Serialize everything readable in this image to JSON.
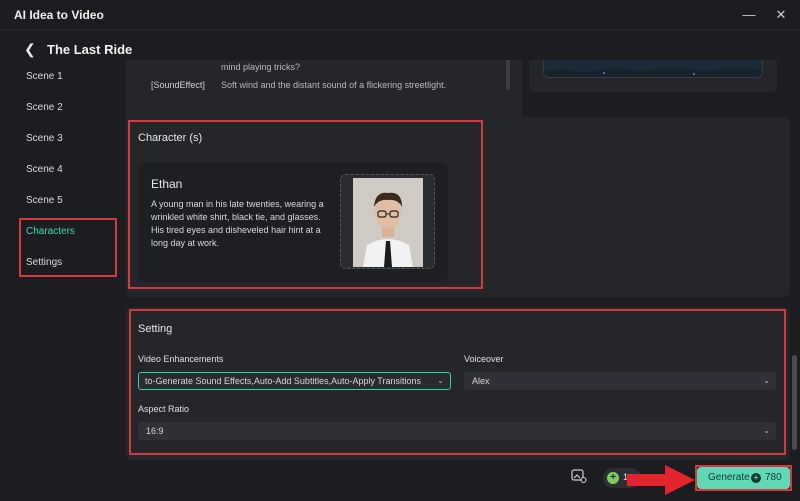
{
  "window": {
    "title": "AI Idea to Video",
    "minimize_icon": "minimize-icon",
    "close_icon": "close-icon"
  },
  "header": {
    "back_icon": "chevron-left-icon",
    "title": "The Last Ride"
  },
  "sidebar": {
    "items": [
      {
        "label": "Scene 1",
        "active": false
      },
      {
        "label": "Scene 2",
        "active": false
      },
      {
        "label": "Scene 3",
        "active": false
      },
      {
        "label": "Scene 4",
        "active": false
      },
      {
        "label": "Scene 5",
        "active": false
      },
      {
        "label": "Characters",
        "active": true
      },
      {
        "label": "Settings",
        "active": false
      }
    ]
  },
  "scene_preview": {
    "line_fragment": "mind playing tricks?",
    "sound_effect_tag": "[SoundEffect]",
    "sound_effect_text": "Soft wind and the distant sound of a flickering streetlight."
  },
  "characters": {
    "heading": "Character (s)",
    "items": [
      {
        "name": "Ethan",
        "description": "A young man in his late twenties, wearing a wrinkled white shirt, black tie, and glasses. His tired eyes and disheveled hair hint at a long day at work."
      }
    ]
  },
  "settings": {
    "heading": "Setting",
    "video_enhancements": {
      "label": "Video Enhancements",
      "value": "to-Generate Sound Effects,Auto-Add Subtitles,Auto-Apply Transitions"
    },
    "voiceover": {
      "label": "Voiceover",
      "value": "Alex"
    },
    "aspect_ratio": {
      "label": "Aspect Ratio",
      "value": "16:9"
    }
  },
  "footer": {
    "image_icon": "image-settings-icon",
    "credits_value": "1",
    "generate_label": "Generate",
    "generate_cost": "780"
  },
  "colors": {
    "accent": "#45d7b1",
    "button": "#5fd8b6",
    "highlight": "#d8383f"
  }
}
